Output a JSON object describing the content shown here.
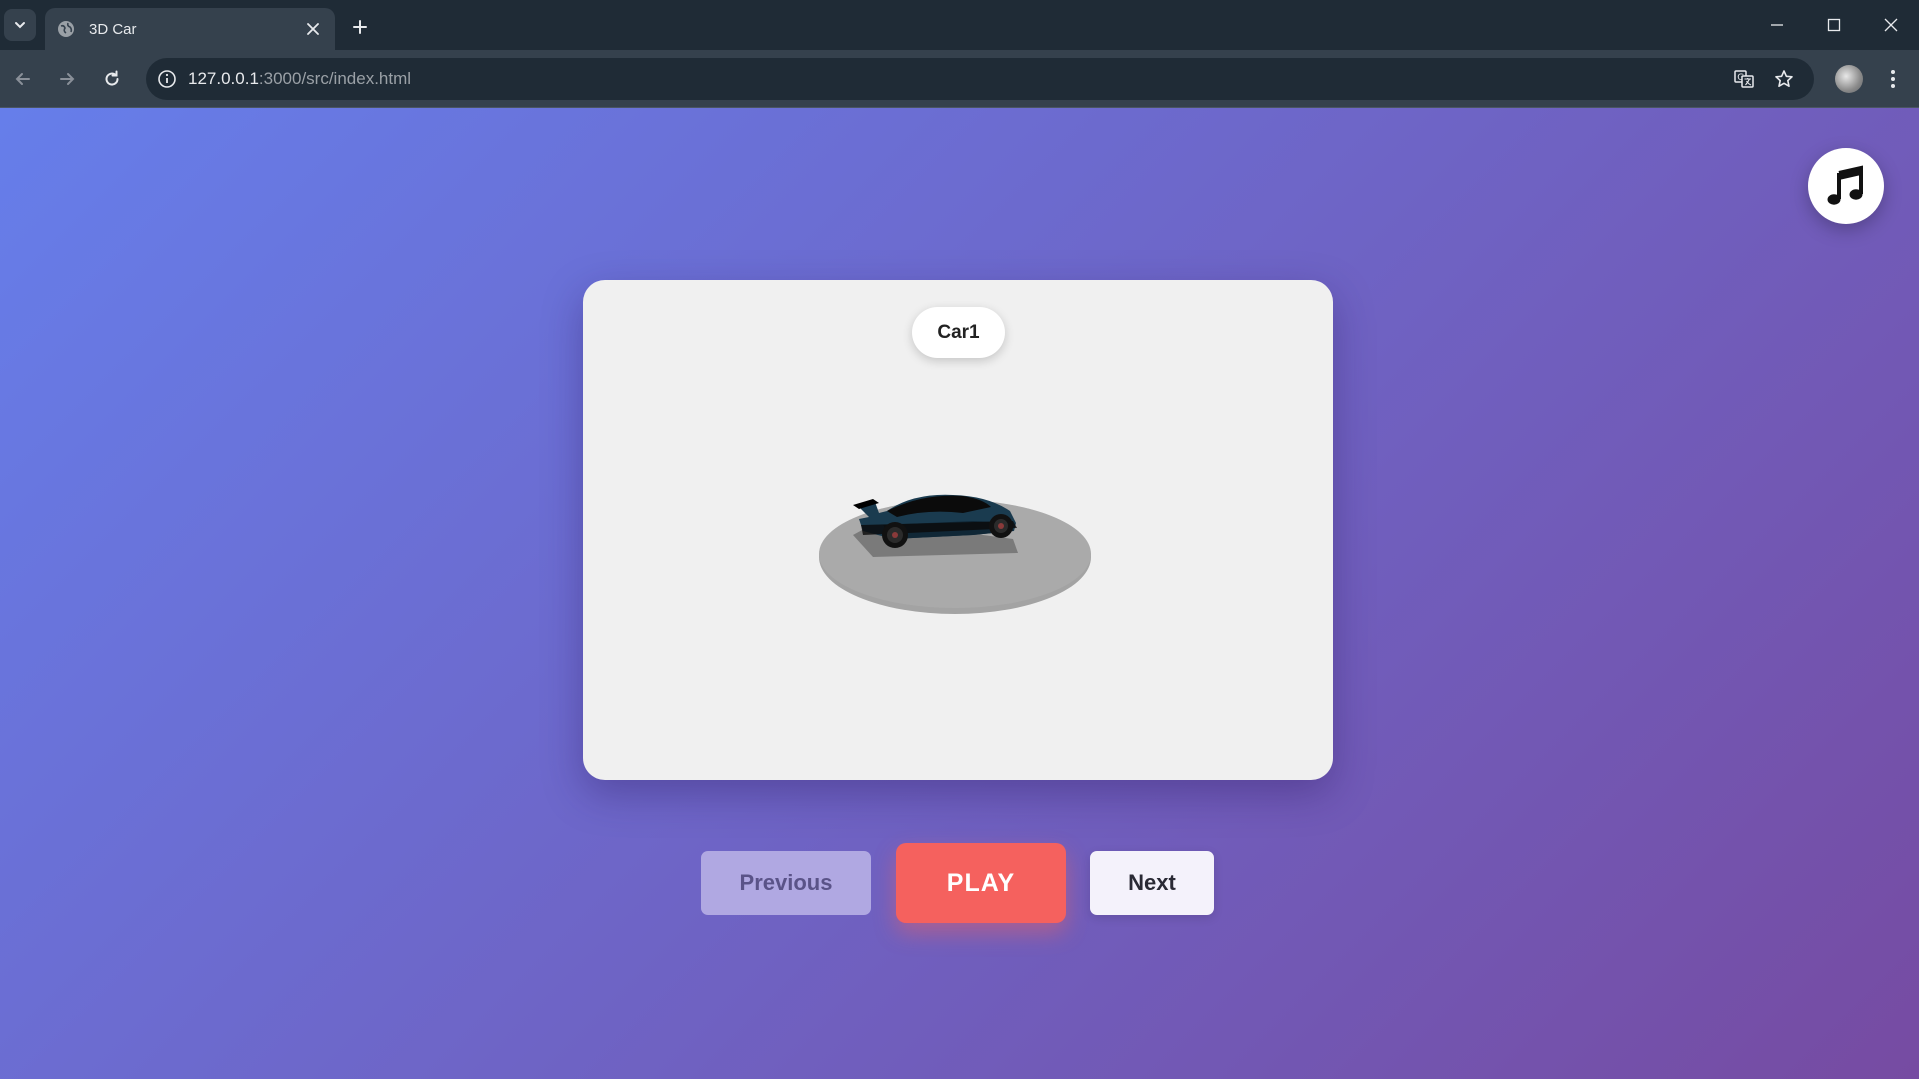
{
  "browser": {
    "tab_title": "3D Car",
    "url_host": "127.0.0.1",
    "url_path": ":3000/src/index.html"
  },
  "page": {
    "car_name": "Car1",
    "buttons": {
      "previous": "Previous",
      "play": "PLAY",
      "next": "Next"
    }
  },
  "icons": {
    "tab_search": "chevron-down-icon",
    "favicon": "globe-icon",
    "tab_close": "close-icon",
    "new_tab": "plus-icon",
    "back": "arrow-left-icon",
    "forward": "arrow-right-icon",
    "reload": "reload-icon",
    "site_info": "info-icon",
    "translate": "translate-icon",
    "bookmark": "star-icon",
    "menu": "more-vertical-icon",
    "music": "music-note-icon"
  },
  "colors": {
    "gradient_start": "#667eea",
    "gradient_end": "#764ba2",
    "play_button": "#f5615e",
    "previous_button": "#b0a8e2",
    "next_button": "#f4f2fb",
    "viewer_background": "#f0f0f0"
  }
}
